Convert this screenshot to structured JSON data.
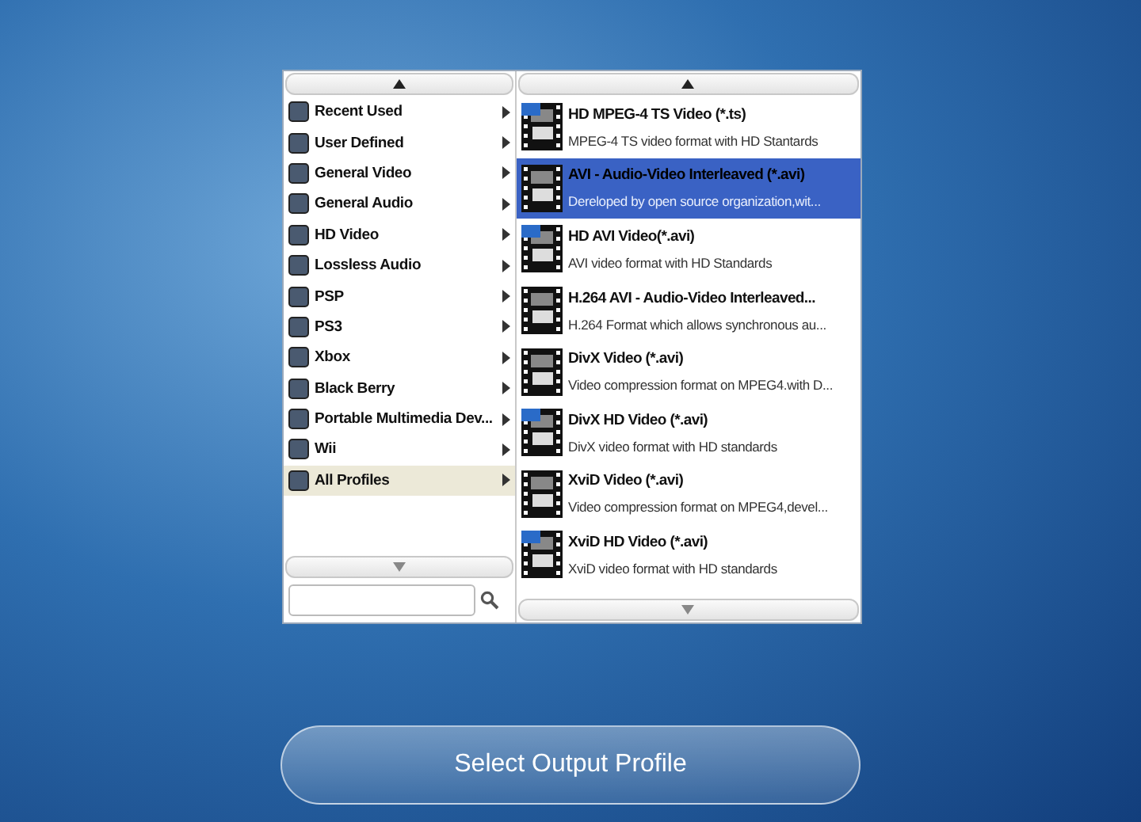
{
  "categories": [
    {
      "label": "Recent Used",
      "selected": false
    },
    {
      "label": "User Defined",
      "selected": false
    },
    {
      "label": "General Video",
      "selected": false
    },
    {
      "label": "General Audio",
      "selected": false
    },
    {
      "label": "HD Video",
      "selected": false
    },
    {
      "label": "Lossless Audio",
      "selected": false
    },
    {
      "label": "PSP",
      "selected": false
    },
    {
      "label": "PS3",
      "selected": false
    },
    {
      "label": "Xbox",
      "selected": false
    },
    {
      "label": "Black Berry",
      "selected": false
    },
    {
      "label": "Portable Multimedia Dev...",
      "selected": false
    },
    {
      "label": "Wii",
      "selected": false
    },
    {
      "label": "All Profiles",
      "selected": true
    }
  ],
  "profiles": [
    {
      "title": "HD MPEG-4 TS Video (*.ts)",
      "description": "MPEG-4 TS video format with HD Stantards",
      "hd": true,
      "selected": false
    },
    {
      "title": "AVI - Audio-Video Interleaved (*.avi)",
      "description": "Dereloped by open source organization,wit...",
      "hd": false,
      "selected": true
    },
    {
      "title": "HD AVI Video(*.avi)",
      "description": "AVI video format with HD Standards",
      "hd": true,
      "selected": false
    },
    {
      "title": "H.264 AVI - Audio-Video Interleaved...",
      "description": "H.264 Format which allows synchronous au...",
      "hd": false,
      "selected": false
    },
    {
      "title": "DivX Video (*.avi)",
      "description": "Video compression format on MPEG4.with D...",
      "hd": false,
      "selected": false
    },
    {
      "title": "DivX HD Video (*.avi)",
      "description": "DivX video format with HD standards",
      "hd": true,
      "selected": false
    },
    {
      "title": "XviD Video (*.avi)",
      "description": "Video compression format on MPEG4,devel...",
      "hd": false,
      "selected": false
    },
    {
      "title": "XviD HD Video (*.avi)",
      "description": "XviD video format with HD standards",
      "hd": true,
      "selected": false
    }
  ],
  "action_button": "Select Output Profile"
}
